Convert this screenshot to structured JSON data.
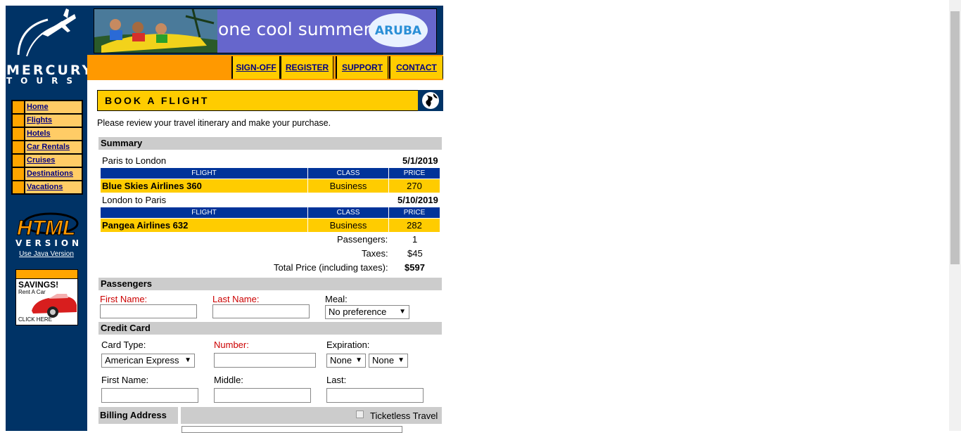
{
  "logo": {
    "line1": "MERCURY",
    "line2": "TOURS"
  },
  "sidebar": {
    "items": [
      {
        "label": "Home"
      },
      {
        "label": "Flights"
      },
      {
        "label": "Hotels"
      },
      {
        "label": "Car Rentals"
      },
      {
        "label": "Cruises"
      },
      {
        "label": "Destinations"
      },
      {
        "label": "Vacations"
      }
    ],
    "html_version_line1": "HTML",
    "html_version_line2": "VERSION",
    "java_link": "Use Java Version",
    "ad": {
      "title": "SAVINGS!",
      "sub": "Rent A Car",
      "cta": "CLICK HERE"
    }
  },
  "banner": {
    "text": "one cool summer",
    "brand": "ARUBA"
  },
  "topnav": {
    "signoff": "SIGN-OFF",
    "register": "REGISTER",
    "support": "SUPPORT",
    "contact": "CONTACT"
  },
  "page": {
    "title": "BOOK A FLIGHT",
    "intro": "Please review your travel itinerary and make your purchase."
  },
  "summary": {
    "heading": "Summary",
    "col_flight": "FLIGHT",
    "col_class": "CLASS",
    "col_price": "PRICE",
    "leg1": {
      "route": "Paris to London",
      "date": "5/1/2019",
      "flight": "Blue Skies Airlines 360",
      "class": "Business",
      "price": "270"
    },
    "leg2": {
      "route": "London to Paris",
      "date": "5/10/2019",
      "flight": "Pangea Airlines 632",
      "class": "Business",
      "price": "282"
    },
    "passengers_label": "Passengers:",
    "passengers_value": "1",
    "taxes_label": "Taxes:",
    "taxes_value": "$45",
    "total_label": "Total Price (including taxes):",
    "total_value": "$597"
  },
  "passengers": {
    "heading": "Passengers",
    "first_label": "First Name:",
    "last_label": "Last Name:",
    "meal_label": "Meal:",
    "meal_value": "No preference"
  },
  "credit": {
    "heading": "Credit Card",
    "type_label": "Card Type:",
    "type_value": "American Express",
    "number_label": "Number:",
    "exp_label": "Expiration:",
    "exp_month": "None",
    "exp_year": "None",
    "first_label": "First Name:",
    "middle_label": "Middle:",
    "last_label": "Last:"
  },
  "billing": {
    "heading": "Billing Address",
    "ticketless": "Ticketless Travel"
  },
  "colors": {
    "sidebar": "#003366",
    "orange": "#ff9900",
    "yellow": "#ffcc00",
    "blue_header": "#003399"
  }
}
